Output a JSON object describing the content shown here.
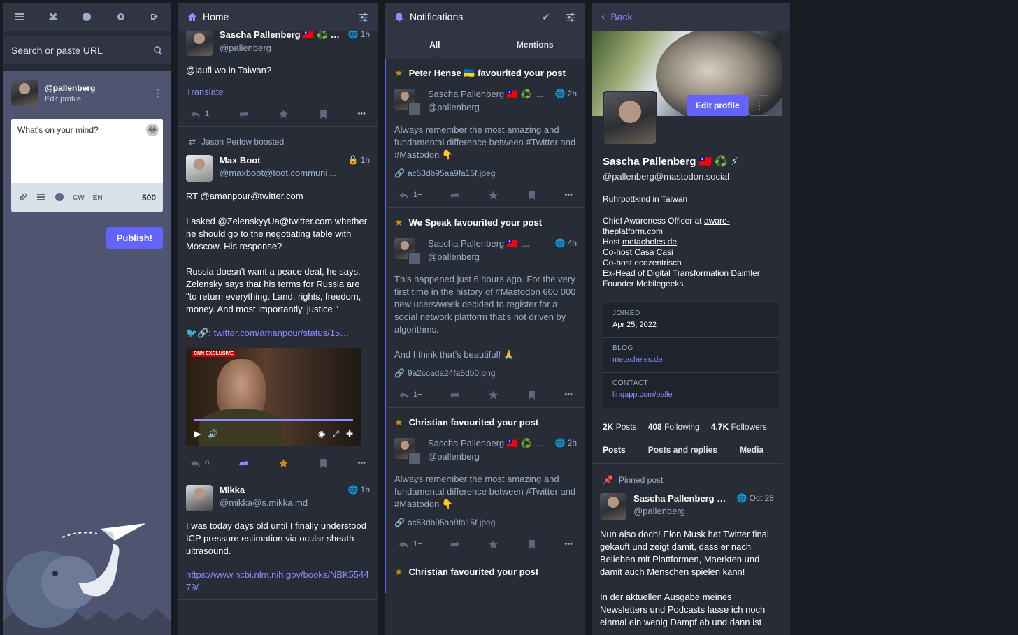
{
  "compose": {
    "search_placeholder": "Search or paste URL",
    "account": "@pallenberg",
    "edit_profile": "Edit profile",
    "placeholder": "What's on your mind?",
    "cw": "CW",
    "lang": "EN",
    "char_count": "500",
    "publish": "Publish!"
  },
  "home": {
    "title": "Home",
    "post1": {
      "name": "Sascha Pallenberg 🇹🇼 ♻️ …",
      "acct": "@pallenberg",
      "time": "1h",
      "body": "@laufi wo in Taiwan?",
      "translate": "Translate",
      "reply_count": "1"
    },
    "post2": {
      "boosted_by": "Jason Perlow boosted",
      "name": "Max Boot",
      "acct": "@maxboot@toot.communi…",
      "time": "1h",
      "body": "RT @amanpour@twitter.com\n\nI asked @ZelenskyyUa@twitter.com whether he should go to the negotiating table with Moscow. His response?\n\nRussia doesn't want a peace deal, he says. Zelensky says that his terms for Russia are \"to return everything. Land, rights, freedom, money. And most importantly, justice.\"",
      "link_prefix": "🐦🔗: ",
      "link": "twitter.com/amanpour/status/15…",
      "video_badge": "CNN EXCLUSIVE",
      "reply_count": "0"
    },
    "post3": {
      "name": "Mikka",
      "acct": "@mikka@s.mikka.md",
      "time": "1h",
      "body": "I was today days old until I finally understood ICP pressure estimation via ocular sheath ultrasound.",
      "link": "https://www.ncbi.nlm.nih.gov/books/NBK554479/"
    }
  },
  "notifications": {
    "title": "Notifications",
    "tab_all": "All",
    "tab_mentions": "Mentions",
    "items": [
      {
        "line": "Peter Hense 🇺🇦 favourited your post",
        "name": "Sascha Pallenberg 🇹🇼 ♻️ …",
        "acct": "@pallenberg",
        "time": "2h",
        "body": "Always remember the most amazing and fundamental difference between #Twitter and #Mastodon 👇",
        "attachment": "ac53db95aa9fa15f.jpeg",
        "reply_count": "1+"
      },
      {
        "line": "We Speak favourited your post",
        "name": "Sascha Pallenberg 🇹🇼 …",
        "acct": "@pallenberg",
        "time": "4h",
        "body": "This happened just 6 hours ago. For the very first time in the history of #Mastodon 600 000 new users/week decided to register for a social network platform that's not driven by algorithms.\n\nAnd I think that's beautiful! 🙏",
        "attachment": "9a2ccada24fa5db0.png",
        "reply_count": "1+"
      },
      {
        "line": "Christian favourited your post",
        "name": "Sascha Pallenberg 🇹🇼 ♻️ …",
        "acct": "@pallenberg",
        "time": "2h",
        "body": "Always remember the most amazing and fundamental difference between #Twitter and #Mastodon 👇",
        "attachment": "ac53db95aa9fa15f.jpeg",
        "reply_count": "1+"
      },
      {
        "line": "Christian favourited your post"
      }
    ]
  },
  "profile": {
    "back": "Back",
    "edit_profile": "Edit profile",
    "name": "Sascha Pallenberg 🇹🇼 ♻️ ⚡",
    "acct": "@pallenberg@mastodon.social",
    "bio_line1": "Ruhrpottkind in Taiwan",
    "bio_cao": "Chief Awareness Officer at ",
    "bio_cao_link": "aware-theplatform.com",
    "bio_host": "Host ",
    "bio_host_link": "metacheles.de",
    "bio_rest1": "Co-host Casa Casi",
    "bio_rest2": "Co-host ecozentrisch",
    "bio_rest3": "Ex-Head of Digital Transformation Daimler",
    "bio_rest4": "Founder Mobilegeeks",
    "fields": [
      {
        "k": "JOINED",
        "v": "Apr 25, 2022"
      },
      {
        "k": "BLOG",
        "v": "metacheles.de"
      },
      {
        "k": "CONTACT",
        "v": "linqapp.com/palle"
      }
    ],
    "posts_count": "2K",
    "posts_label": "Posts",
    "following_count": "408",
    "following_label": "Following",
    "followers_count": "4.7K",
    "followers_label": "Followers",
    "tabs": [
      "Posts",
      "Posts and replies",
      "Media"
    ],
    "pinned_label": "Pinned post",
    "pinned": {
      "name": "Sascha Pallenberg …",
      "acct": "@pallenberg",
      "time": "Oct 28",
      "body": "Nun also doch! Elon Musk hat Twitter final gekauft und zeigt damit, dass er nach Belieben mit Plattformen, Maerkten und damit auch Menschen spielen kann!\n\nIn der aktuellen Ausgabe meines Newsletters und Podcasts lasse ich noch einmal ein wenig Dampf ab und dann ist"
    }
  },
  "colors": {
    "accent": "#6364ff",
    "panel": "#282c37",
    "header": "#313543",
    "star": "#ca8f04"
  }
}
